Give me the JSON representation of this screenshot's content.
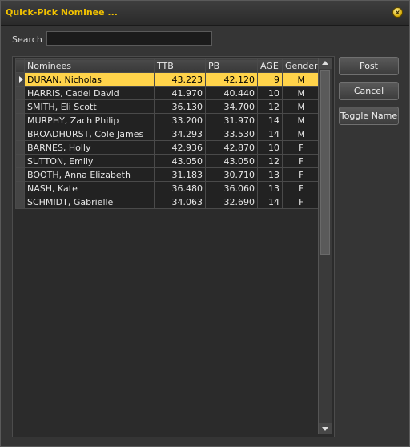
{
  "window": {
    "title": "Quick-Pick Nominee ...",
    "close_icon": "x"
  },
  "search": {
    "label": "Search",
    "value": ""
  },
  "grid": {
    "columns": [
      "Nominees",
      "TTB",
      "PB",
      "AGE",
      "Gender"
    ],
    "selected_index": 0,
    "rows": [
      {
        "name": "DURAN, Nicholas",
        "ttb": "43.223",
        "pb": "42.120",
        "age": "9",
        "gender": "M"
      },
      {
        "name": "HARRIS, Cadel David",
        "ttb": "41.970",
        "pb": "40.440",
        "age": "10",
        "gender": "M"
      },
      {
        "name": "SMITH, Eli Scott",
        "ttb": "36.130",
        "pb": "34.700",
        "age": "12",
        "gender": "M"
      },
      {
        "name": "MURPHY, Zach Philip",
        "ttb": "33.200",
        "pb": "31.970",
        "age": "14",
        "gender": "M"
      },
      {
        "name": "BROADHURST, Cole James",
        "ttb": "34.293",
        "pb": "33.530",
        "age": "14",
        "gender": "M"
      },
      {
        "name": "BARNES, Holly",
        "ttb": "42.936",
        "pb": "42.870",
        "age": "10",
        "gender": "F"
      },
      {
        "name": "SUTTON, Emily",
        "ttb": "43.050",
        "pb": "43.050",
        "age": "12",
        "gender": "F"
      },
      {
        "name": "BOOTH, Anna Elizabeth",
        "ttb": "31.183",
        "pb": "30.710",
        "age": "13",
        "gender": "F"
      },
      {
        "name": "NASH, Kate",
        "ttb": "36.480",
        "pb": "36.060",
        "age": "13",
        "gender": "F"
      },
      {
        "name": "SCHMIDT, Gabrielle",
        "ttb": "34.063",
        "pb": "32.690",
        "age": "14",
        "gender": "F"
      }
    ]
  },
  "buttons": {
    "post": "Post",
    "cancel": "Cancel",
    "toggle_name": "Toggle Name"
  },
  "colors": {
    "title": "#f2c200",
    "selected_row": "#ffd34a"
  }
}
